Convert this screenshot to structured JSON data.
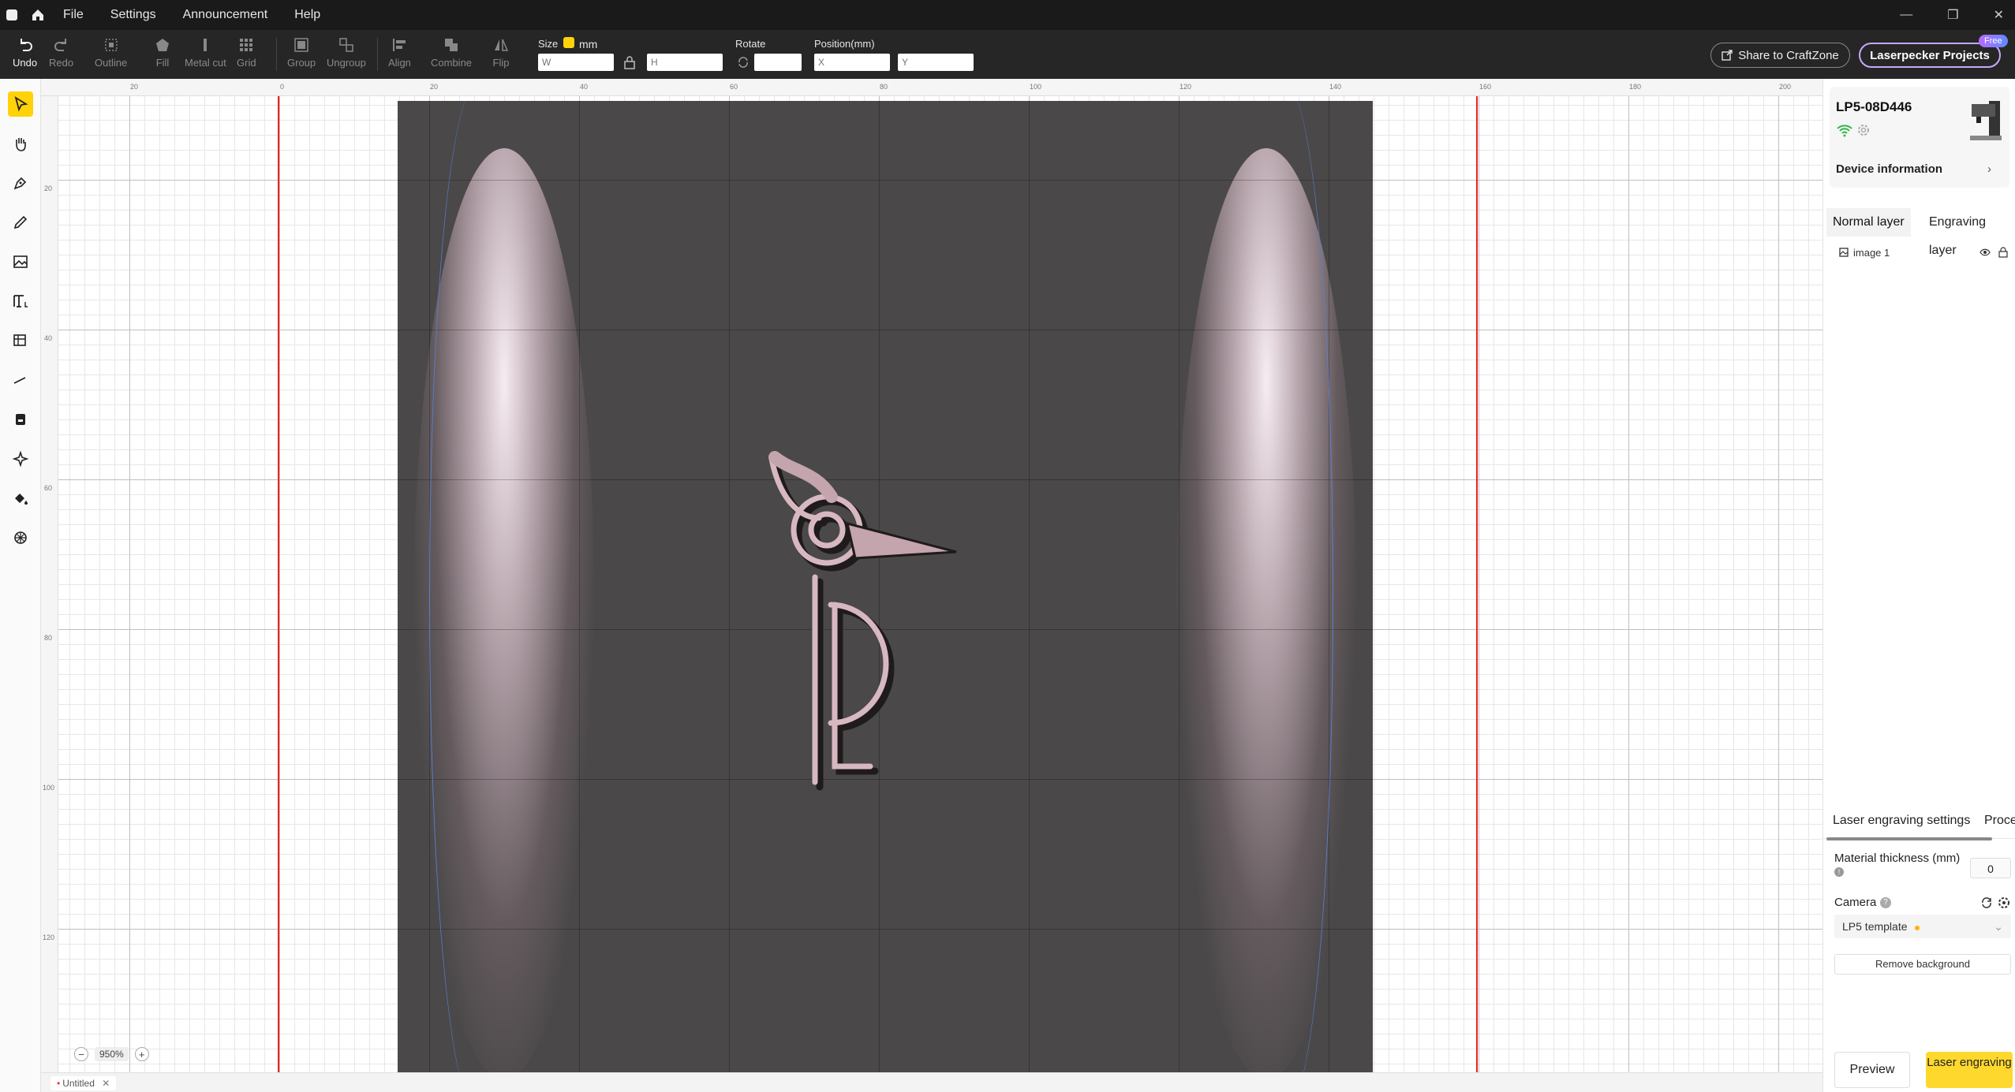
{
  "menu": [
    "File",
    "Settings",
    "Announcement",
    "Help"
  ],
  "window_controls": [
    "—",
    "❐",
    "✕"
  ],
  "toolbar": {
    "undo": "Undo",
    "redo": "Redo",
    "outline": "Outline",
    "fill": "Fill",
    "metal_cut": "Metal cut",
    "grid": "Grid",
    "group": "Group",
    "ungroup": "Ungroup",
    "align": "Align",
    "combine": "Combine",
    "flip": "Flip",
    "size_label": "Size",
    "size_unit": "mm",
    "w_placeholder": "W",
    "h_placeholder": "H",
    "rotate_label": "Rotate",
    "position_label": "Position(mm)",
    "x_placeholder": "X",
    "y_placeholder": "Y",
    "share": "Share to CraftZone",
    "projects": "Laserpecker Projects",
    "free_badge": "Free"
  },
  "ruler": {
    "top": [
      "20",
      "0",
      "20",
      "40",
      "60",
      "80",
      "100",
      "120",
      "140",
      "160",
      "180",
      "200"
    ],
    "left": [
      "20",
      "40",
      "60",
      "80",
      "100",
      "120"
    ]
  },
  "zoom": {
    "minus": "−",
    "value": "950%",
    "plus": "+"
  },
  "doc_tab": "Untitled",
  "device": {
    "name": "LP5-08D446",
    "info": "Device information"
  },
  "layers": {
    "tab_normal": "Normal layer",
    "tab_engraving": "Engraving layer",
    "items": [
      {
        "name": "image 1"
      }
    ]
  },
  "settings": {
    "tab_laser": "Laser engraving settings",
    "tab_process": "Proces",
    "thickness_label": "Material thickness (mm)",
    "thickness_value": "0",
    "camera_label": "Camera",
    "camera_template": "LP5 template",
    "remove_bg": "Remove background"
  },
  "actions": {
    "preview": "Preview",
    "laser": "Laser engraving"
  },
  "colors": {
    "accent": "#ffd20a",
    "guide_red": "#e22222",
    "guide_blue": "#5a7fd0"
  }
}
